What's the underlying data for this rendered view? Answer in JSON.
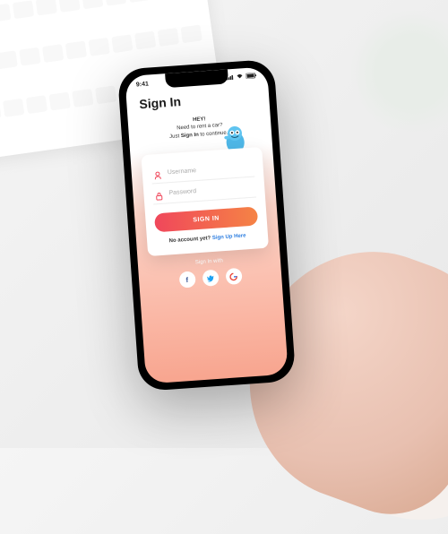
{
  "status": {
    "time": "9:41",
    "signal": "•••",
    "wifi": "⬡",
    "battery": "▬"
  },
  "title": "Sign In",
  "hero": {
    "line1": "HEY!",
    "line2_a": "Need to rent a car?",
    "line3_a": "Just ",
    "line3_b": "Sign In",
    "line3_c": " to continue..."
  },
  "form": {
    "username": {
      "placeholder": "Username",
      "value": ""
    },
    "password": {
      "placeholder": "Password",
      "value": ""
    },
    "submit_label": "SIGN IN"
  },
  "signup": {
    "prompt": "No account yet? ",
    "link": "Sign Up Here"
  },
  "social": {
    "label": "Sign In with",
    "facebook": "f",
    "twitter": "t",
    "google": "G"
  },
  "colors": {
    "gradient_start": "#f0475b",
    "gradient_end": "#f58345",
    "link": "#2b7de0"
  }
}
